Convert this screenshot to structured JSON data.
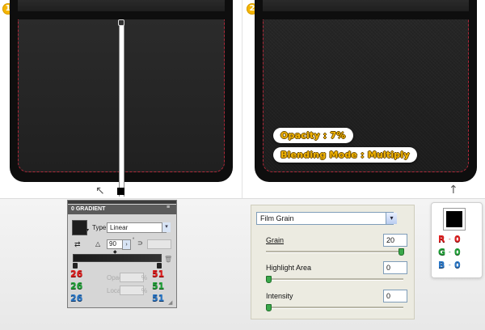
{
  "steps": [
    "1",
    "2"
  ],
  "step2": {
    "opacity_label": "Opacity : 7%",
    "blend_label": "Blending Mode : Multiply"
  },
  "gradient_panel": {
    "title": "0 GRADIENT",
    "type_label": "Type:",
    "type_value": "Linear",
    "angle_value": "90",
    "opacity_label": "Opacity:",
    "location_label": "Location:",
    "left_rgb": [
      "26",
      "26",
      "26"
    ],
    "right_rgb": [
      "51",
      "51",
      "51"
    ]
  },
  "film_grain": {
    "filter": "Film Grain",
    "grain_label": "Grain",
    "grain_value": "20",
    "grain_level": 1.0,
    "highlight_label": "Highlight Area",
    "highlight_value": "0",
    "highlight_level": 0.0,
    "intensity_label": "Intensity",
    "intensity_value": "0",
    "intensity_level": 0.0
  },
  "fill_color": {
    "swatch_hex": "#000000",
    "r_label": "R",
    "r_value": "0",
    "g_label": "G",
    "g_value": "0",
    "b_label": "B",
    "b_value": "0"
  }
}
